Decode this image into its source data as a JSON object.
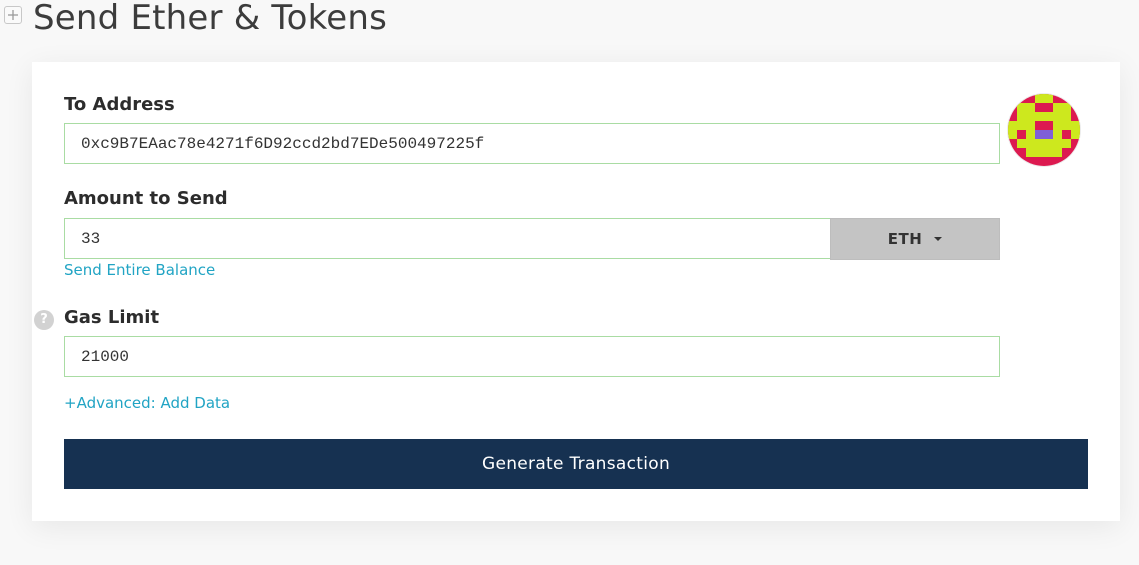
{
  "page": {
    "title": "Send Ether & Tokens"
  },
  "form": {
    "to_address": {
      "label": "To Address",
      "value": "0xc9B7EAac78e4271f6D92ccd2bd7EDe500497225f"
    },
    "amount": {
      "label": "Amount to Send",
      "value": "33",
      "unit": "ETH",
      "send_entire_balance": "Send Entire Balance"
    },
    "gas_limit": {
      "label": "Gas Limit",
      "value": "21000",
      "help_glyph": "?"
    },
    "advanced_link": "+Advanced: Add Data",
    "submit_label": "Generate Transaction"
  },
  "colors": {
    "button_bg": "#163151",
    "link": "#21a4c4",
    "input_border": "#a9dca3",
    "identicon_primary": "#dc1a50",
    "identicon_secondary": "#cde81e",
    "identicon_accent": "#7f5fd8"
  }
}
